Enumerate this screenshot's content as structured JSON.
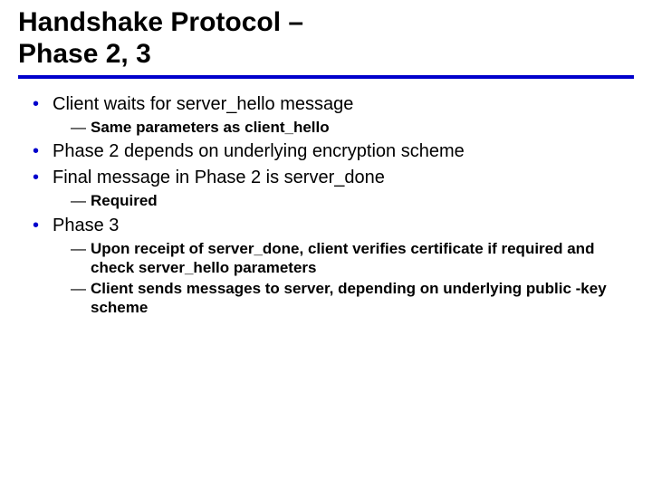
{
  "slide": {
    "title_line1": "Handshake Protocol –",
    "title_line2": "Phase 2, 3",
    "bullets": {
      "b0": {
        "text": "Client waits for server_hello message",
        "subs": {
          "s0": "Same parameters as client_hello"
        }
      },
      "b1": {
        "text": "Phase 2 depends on underlying encryption scheme"
      },
      "b2": {
        "text": "Final message in Phase 2 is server_done",
        "subs": {
          "s0": "Required"
        }
      },
      "b3": {
        "text": "Phase 3",
        "subs": {
          "s0": "Upon receipt of server_done, client verifies certificate if required and check server_hello parameters",
          "s1": "Client sends messages to server, depending on underlying public -key scheme"
        }
      }
    }
  }
}
